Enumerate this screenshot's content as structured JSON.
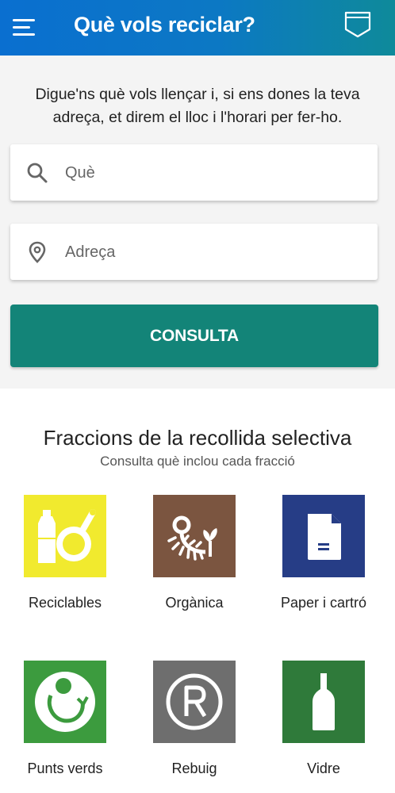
{
  "header": {
    "title": "Què vols reciclar?",
    "menu_icon": "hamburger-menu-icon",
    "shield_icon": "shield-icon",
    "background": "#0a6fd0"
  },
  "search": {
    "intro": "Digue'ns què vols llençar i, si ens dones la teva adreça, et direm el lloc i l'horari per fer-ho.",
    "what_placeholder": "Què",
    "what_icon": "search-icon",
    "where_placeholder": "Adreça",
    "where_icon": "location-pin-icon",
    "button_label": "CONSULTA",
    "button_color": "#138478"
  },
  "fractions": {
    "title": "Fraccions de la recollida selectiva",
    "subtitle": "Consulta què inclou cada fracció",
    "items": [
      {
        "label": "Reciclables",
        "color": "#f1ea2e",
        "icon": "bottle-and-pan-icon"
      },
      {
        "label": "Orgànica",
        "color": "#7b5540",
        "icon": "fish-bone-and-sprout-icon"
      },
      {
        "label": "Paper i cartró",
        "color": "#263d86",
        "icon": "document-icon"
      },
      {
        "label": "Punts verds",
        "color": "#3c9b3e",
        "icon": "recycle-circle-icon"
      },
      {
        "label": "Rebuig",
        "color": "#6e6e6e",
        "icon": "registered-r-icon"
      },
      {
        "label": "Vidre",
        "color": "#2f7a3a",
        "icon": "glass-bottle-icon"
      }
    ]
  }
}
